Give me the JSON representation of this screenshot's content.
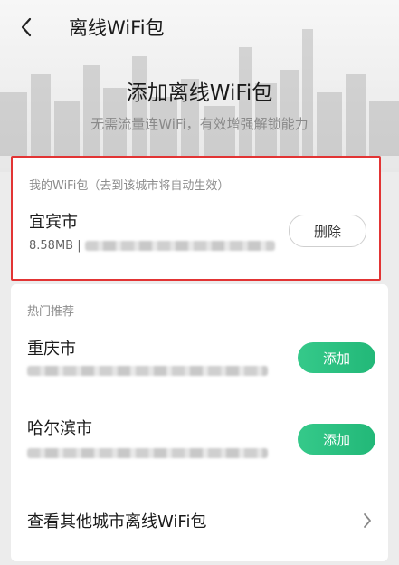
{
  "header": {
    "title": "离线WiFi包",
    "back_icon": "chevron-left-icon"
  },
  "hero": {
    "title": "添加离线WiFi包",
    "subtitle": "无需流量连WiFi，有效增强解锁能力"
  },
  "my_packages": {
    "section_label": "我的WiFi包（去到该城市将自动生效）",
    "items": [
      {
        "city": "宜宾市",
        "size": "8.58MB |",
        "action_label": "删除"
      }
    ]
  },
  "hot": {
    "section_label": "热门推荐",
    "items": [
      {
        "city": "重庆市",
        "action_label": "添加"
      },
      {
        "city": "哈尔滨市",
        "action_label": "添加"
      }
    ],
    "more_label": "查看其他城市离线WiFi包",
    "more_icon": "chevron-right-icon"
  },
  "colors": {
    "accent": "#2bbf80",
    "highlight_border": "#e23434"
  }
}
